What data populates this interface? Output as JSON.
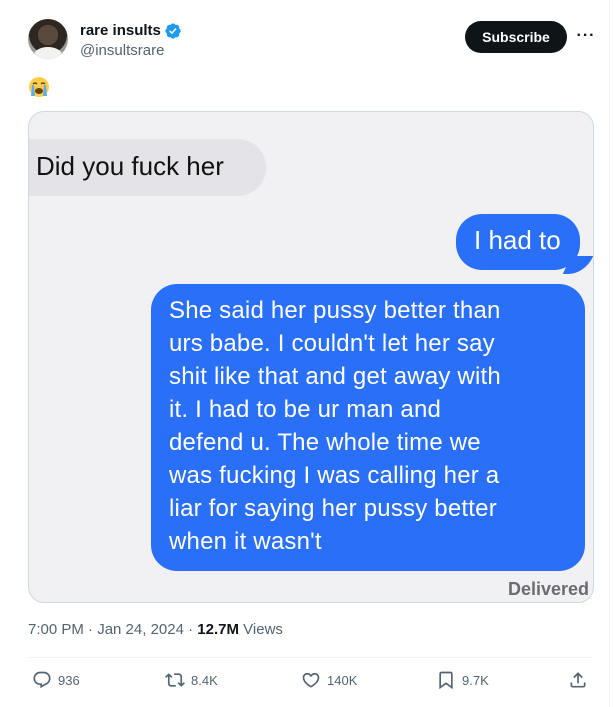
{
  "tweet": {
    "author_name": "rare insults",
    "handle": "@insultsrare",
    "subscribe_label": "Subscribe",
    "more_label": "···",
    "text_emoji": "😭",
    "timestamp": "7:00 PM · Jan 24, 2024",
    "separator": " · ",
    "views_count": "12.7M",
    "views_label": "Views"
  },
  "image_content": {
    "received_message": "Did you fuck her",
    "sent_message_1": "I had to",
    "sent_message_2_lines": [
      "She said her pussy better than",
      "urs babe. I couldn't let her say",
      "shit like that and get away with",
      "it. I had to be ur man and",
      "defend u. The whole time we",
      "was fucking I was calling her a",
      "liar for saying her pussy better",
      "when it wasn't"
    ],
    "status": "Delivered"
  },
  "actions": {
    "replies": "936",
    "reposts": "8.4K",
    "likes": "140K",
    "bookmarks": "9.7K"
  },
  "colors": {
    "accent_blue": "#1d9bf0",
    "imessage_blue": "#2a6ff7",
    "text_secondary": "#536471",
    "subscribe_bg": "#0f1419"
  }
}
